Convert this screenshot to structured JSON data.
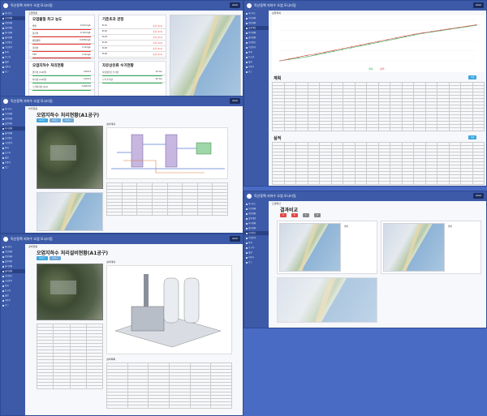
{
  "app": {
    "title": "독산동팩 지하수 오염 모니터링",
    "logout": "LOGO"
  },
  "p1": {
    "breadcrumb": "오염현황",
    "cards": [
      {
        "title": "오염물질 최고 농도",
        "rows": [
          {
            "label": "벤젠",
            "sub": "1.0 mg/L 기준",
            "value": "0.5/1mg/L"
          },
          {
            "label": "톨루엔",
            "sub": "",
            "value": "0.1/1mg/L"
          },
          {
            "label": "에틸벤젠",
            "sub": "",
            "value": "0.005mg/L"
          },
          {
            "label": "자일렌",
            "sub": "",
            "value": "0.3mg/L"
          },
          {
            "label": "TPH",
            "sub": "",
            "value": "0.4mg/L"
          }
        ]
      },
      {
        "title": "기준초과 관정",
        "rows": [
          {
            "label": "B-01",
            "value": "초과 (0.2)"
          },
          {
            "label": "B-02",
            "value": "초과 (0.3)"
          },
          {
            "label": "B-03",
            "value": "초과 (0.1)"
          },
          {
            "label": "B-04",
            "value": "초과 (0.4)"
          },
          {
            "label": "B-05",
            "value": "초과 (0.2)"
          },
          {
            "label": "B-06",
            "value": "초과 (0.3)"
          }
        ]
      },
      {
        "title": "오염지하수 처리현황",
        "rows": [
          {
            "label": "양수량 (m3/일)",
            "value": "120m3"
          },
          {
            "label": "처리량 (m3/일)",
            "value": "110m3"
          },
          {
            "label": "누적처리량 (m3)",
            "value": "3,200m3"
          }
        ]
      },
      {
        "title": "자유상유류 수거현황",
        "rows": [
          {
            "label": "자유상유류 수거량",
            "value": "10 ton"
          },
          {
            "label": "누적 수거량",
            "value": "50 ton"
          }
        ]
      }
    ]
  },
  "p2": {
    "breadcrumb": "실행계획",
    "plan_title": "계획",
    "actual_title": "실적",
    "save": "저장",
    "legend": [
      "계획",
      "실적"
    ]
  },
  "p3": {
    "breadcrumb": "처리현황",
    "title": "오염지하수 처리현황(A1공구)",
    "tabs": [
      "A1공구",
      "A2공구",
      "A3공구"
    ],
    "section": "설비계획",
    "photo": "위성사진"
  },
  "p4": {
    "breadcrumb": "오염확산",
    "title": "결과비교",
    "tabs": [
      "A",
      "B",
      "C",
      "D"
    ],
    "legend_a": "범례",
    "legend_b": "범례"
  },
  "p5": {
    "breadcrumb": "설비현황",
    "title": "오염지하수 처리설비현황(A1공구)",
    "tabs": [
      "A1공구",
      "A2공구"
    ],
    "section": "설비계획",
    "section2": "설비목록"
  },
  "sidebar": [
    "대시보드",
    "오염현황",
    "관정현황",
    "실행계획",
    "처리현황",
    "설비현황",
    "오염확산",
    "수질분석",
    "통계",
    "보고서",
    "설정",
    "사용자",
    "로그"
  ],
  "chart_data": {
    "type": "line",
    "x": [
      1,
      2,
      3,
      4,
      5,
      6,
      7,
      8,
      9,
      10,
      11,
      12,
      13,
      14,
      15,
      16,
      17,
      18,
      19,
      20,
      21,
      22,
      23
    ],
    "series": [
      {
        "name": "계획",
        "values": [
          0,
          3,
          6,
          9,
          13,
          17,
          21,
          25,
          29,
          33,
          37,
          41,
          45,
          49,
          53,
          57,
          61,
          64,
          67,
          70,
          73,
          76,
          79
        ]
      },
      {
        "name": "실적",
        "values": [
          0,
          4,
          8,
          12,
          15,
          19,
          23,
          27,
          31,
          35,
          39,
          43,
          47,
          51,
          55,
          59,
          62,
          65,
          68,
          71,
          74,
          77,
          80
        ]
      }
    ],
    "colors": [
      "#2eae5a",
      "#e04848"
    ]
  }
}
